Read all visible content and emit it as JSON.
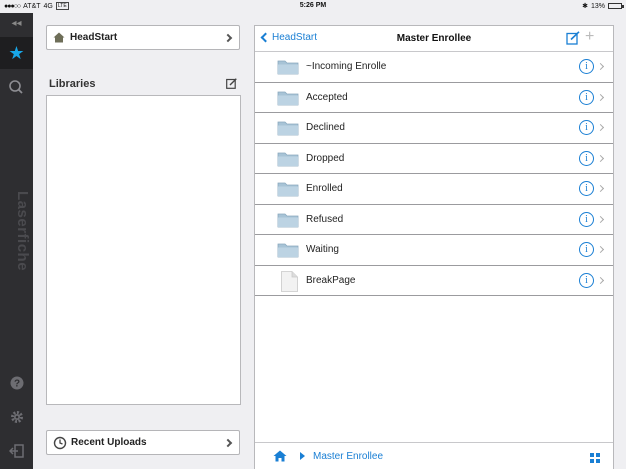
{
  "status_bar": {
    "signal": "●●●○○",
    "carrier": "AT&T",
    "network": "4G",
    "lte": "LTE",
    "time": "5:26 PM",
    "bluetooth": "✱",
    "battery": "13%"
  },
  "rail": {
    "brand": "Laserfiche",
    "collapse_glyph": "◂◂"
  },
  "sidebar": {
    "favorite_label": "HeadStart",
    "libraries_title": "Libraries",
    "recent_uploads_label": "Recent Uploads"
  },
  "main": {
    "back_label": "HeadStart",
    "title": "Master Enrollee",
    "items": [
      {
        "name": "~Incoming Enrolle",
        "type": "folder"
      },
      {
        "name": "Accepted",
        "type": "folder"
      },
      {
        "name": "Declined",
        "type": "folder"
      },
      {
        "name": "Dropped",
        "type": "folder"
      },
      {
        "name": "Enrolled",
        "type": "folder"
      },
      {
        "name": "Refused",
        "type": "folder"
      },
      {
        "name": "Waiting",
        "type": "folder"
      },
      {
        "name": "BreakPage",
        "type": "document"
      }
    ],
    "info_glyph": "i",
    "breadcrumb": "Master Enrollee"
  },
  "colors": {
    "accent": "#1a7fd4",
    "star": "#18a7e8",
    "rail": "#2e2e31"
  }
}
